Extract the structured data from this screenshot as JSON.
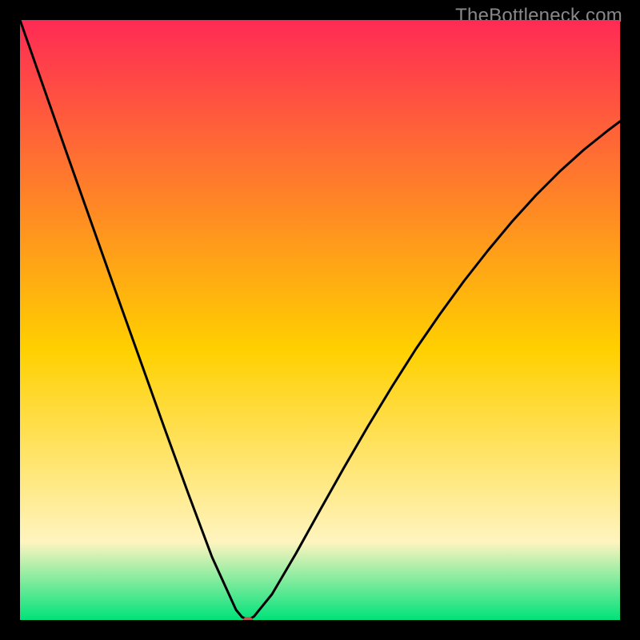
{
  "watermark": "TheBottleneck.com",
  "chart_data": {
    "type": "line",
    "title": "",
    "xlabel": "",
    "ylabel": "",
    "xlim": [
      0,
      100
    ],
    "ylim": [
      0,
      100
    ],
    "grid": false,
    "background_gradient": [
      "#ff2a55",
      "#ffd000",
      "#fff4bf",
      "#00e27a"
    ],
    "series": [
      {
        "name": "curve",
        "x": [
          0,
          4,
          8,
          12,
          16,
          20,
          24,
          28,
          32,
          36,
          37,
          38,
          39,
          42,
          46,
          50,
          54,
          58,
          62,
          66,
          70,
          74,
          78,
          82,
          86,
          90,
          94,
          98,
          100
        ],
        "y": [
          100,
          88.6,
          77.2,
          65.9,
          54.6,
          43.4,
          32.2,
          21.2,
          10.5,
          1.7,
          0.5,
          0.0,
          0.6,
          4.3,
          11.1,
          18.3,
          25.4,
          32.3,
          38.9,
          45.2,
          51.0,
          56.5,
          61.6,
          66.4,
          70.8,
          74.8,
          78.4,
          81.6,
          83.1
        ]
      }
    ],
    "marker": {
      "x": 38,
      "y": 0,
      "color": "#bb5a55",
      "rx": 6,
      "ry": 4
    },
    "annotations": []
  },
  "colors": {
    "frame": "#000000",
    "watermark": "#888888",
    "curve": "#000000"
  }
}
